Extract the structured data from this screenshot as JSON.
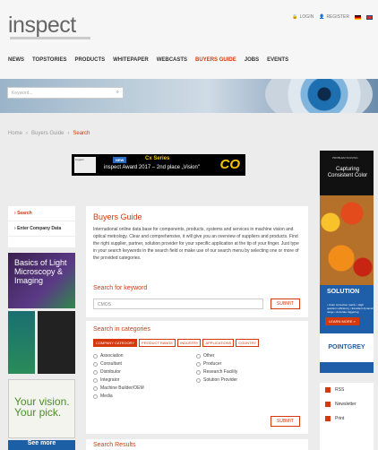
{
  "header": {
    "logo": "inspect",
    "links": {
      "login": "LOGIN",
      "register": "REGISTER"
    },
    "nav": [
      "NEWS",
      "TOPSTORIES",
      "PRODUCTS",
      "WHITEPAPER",
      "WEBCASTS",
      "BUYERS GUIDE",
      "JOBS",
      "EVENTS"
    ],
    "search_placeholder": "Keyword..."
  },
  "breadcrumb": {
    "home": "Home",
    "parent": "Buyers Guide",
    "current": "Search"
  },
  "banner": {
    "new": "NEW",
    "series": "Cx Series",
    "award": "inspect Award 2017 – 2nd place „Vision\"",
    "mark": "CO"
  },
  "sidebar": {
    "items": [
      "Search",
      "Enter Company Data"
    ],
    "ads": [
      "Basics of Light Microscopy & Imaging",
      "Your vision. Your pick.",
      "See more"
    ]
  },
  "main": {
    "title": "Buyers Guide",
    "intro": "International online data base for components, products, systems and services in machine vision and optical metrology. Clear and comprehensive, it will give you an overview of suppliers and products. Find the right supplier, partner, solution provider for your specific application at the tip of your finger. Just type in your search keywords in the search field or make use of our search menu by selecting one or more of the provided categories.",
    "keyword_title": "Search for keyword",
    "keyword_value": "CMOS",
    "submit_label": "SUBMIT",
    "categories_title": "Search in categories",
    "tabs": [
      "COMPANY CATEGORY",
      "PRODUCT RANGE",
      "INDUSTRY",
      "APPLICATIONS",
      "COUNTRY"
    ],
    "categories": [
      "Association",
      "Other",
      "Consultant",
      "Producer",
      "Distributor",
      "Research Facility",
      "Integrator",
      "Solution Provider",
      "Machine Builder/OEM",
      "",
      "Media",
      ""
    ],
    "results_title": "Search Results"
  },
  "right_ad": {
    "top_small": "PROBLEM SOLVING",
    "headline": "Capturing Consistent Color",
    "solution": "SOLUTION",
    "features": "• Color correction matrix • High quantum efficiency • Excellent dynamic range • Accurate triggering",
    "learn_more": "LEARN MORE »",
    "brand": "POINTGREY"
  },
  "share": [
    "RSS",
    "Newsletter",
    "Print"
  ]
}
